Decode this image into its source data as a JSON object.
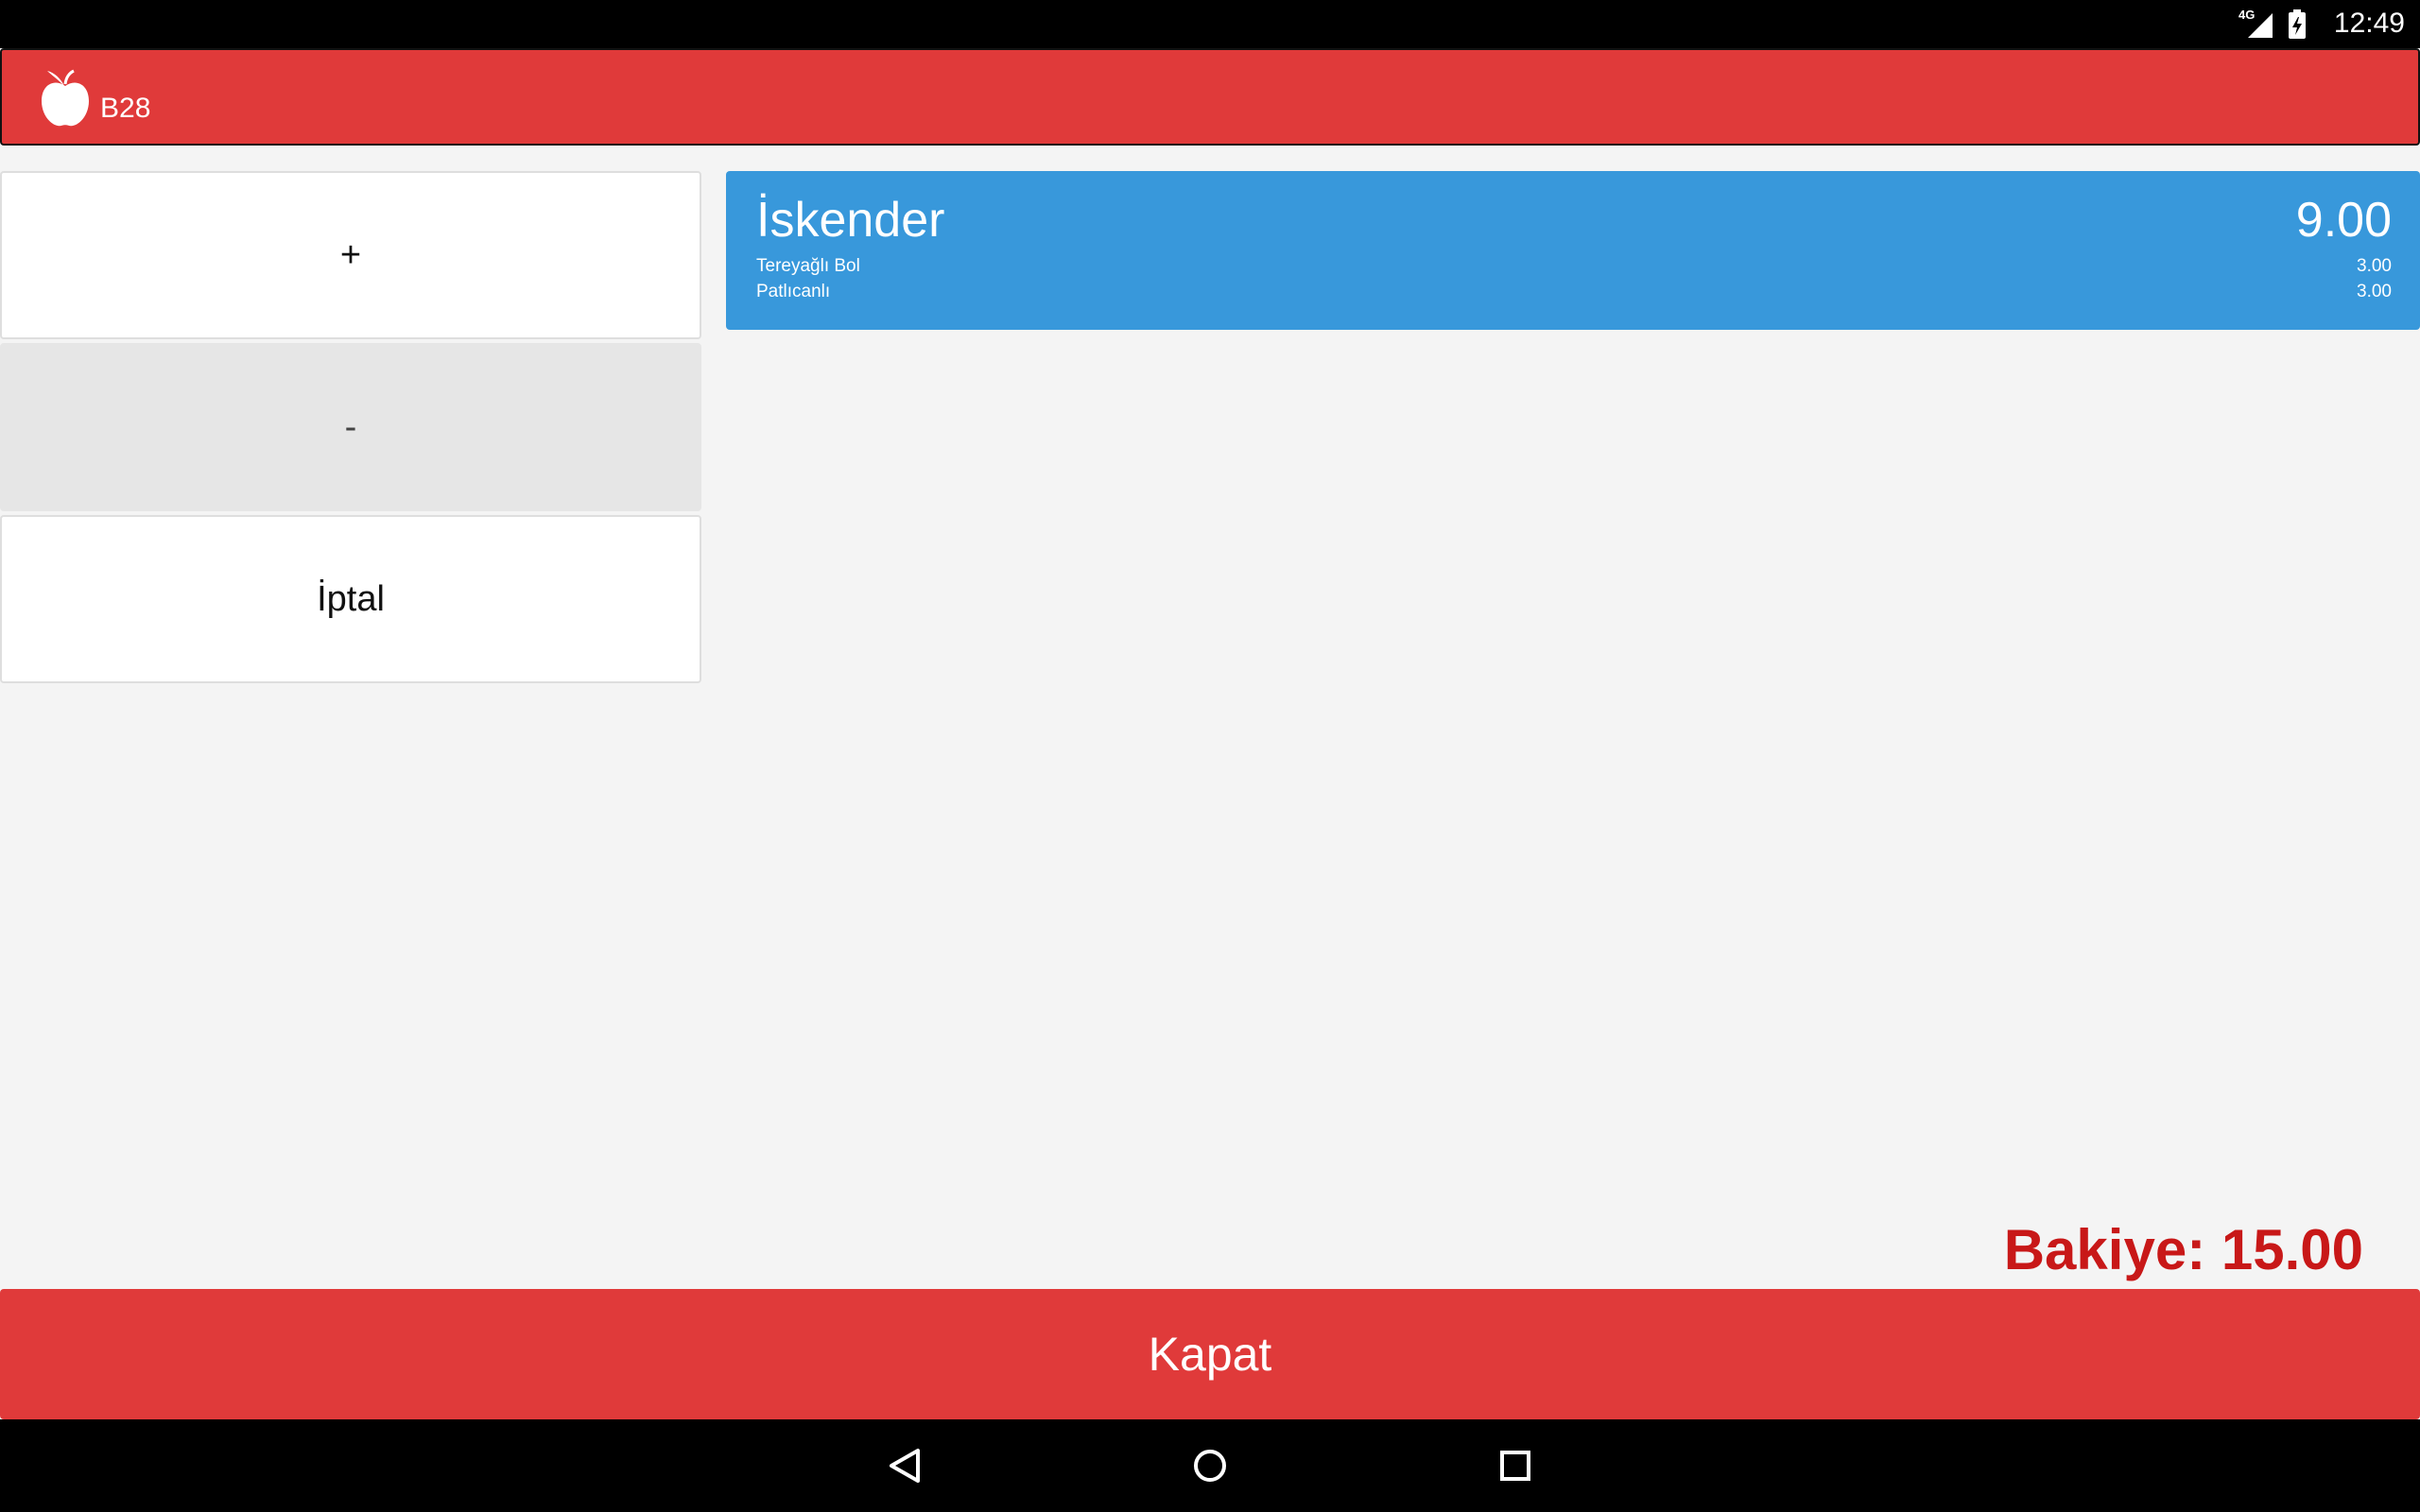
{
  "status_bar": {
    "network": "4G",
    "time": "12:49",
    "icons": [
      "signal-icon",
      "battery-charging-icon"
    ]
  },
  "app_bar": {
    "logo": "apple-logo-icon",
    "title": "B28",
    "color": "#e03a3a"
  },
  "actions": {
    "plus_label": "+",
    "minus_label": "-",
    "cancel_label": "İptal"
  },
  "order": {
    "color": "#3898db",
    "item": {
      "name": "İskender",
      "price": "9.00",
      "modifiers": [
        {
          "name": "Tereyağlı Bol",
          "price": "3.00"
        },
        {
          "name": "Patlıcanlı",
          "price": "3.00"
        }
      ]
    }
  },
  "balance_text": "Bakiye: 15.00",
  "close_label": "Kapat",
  "nav_bar": {
    "icons": [
      "back-icon",
      "home-icon",
      "recents-icon"
    ]
  }
}
